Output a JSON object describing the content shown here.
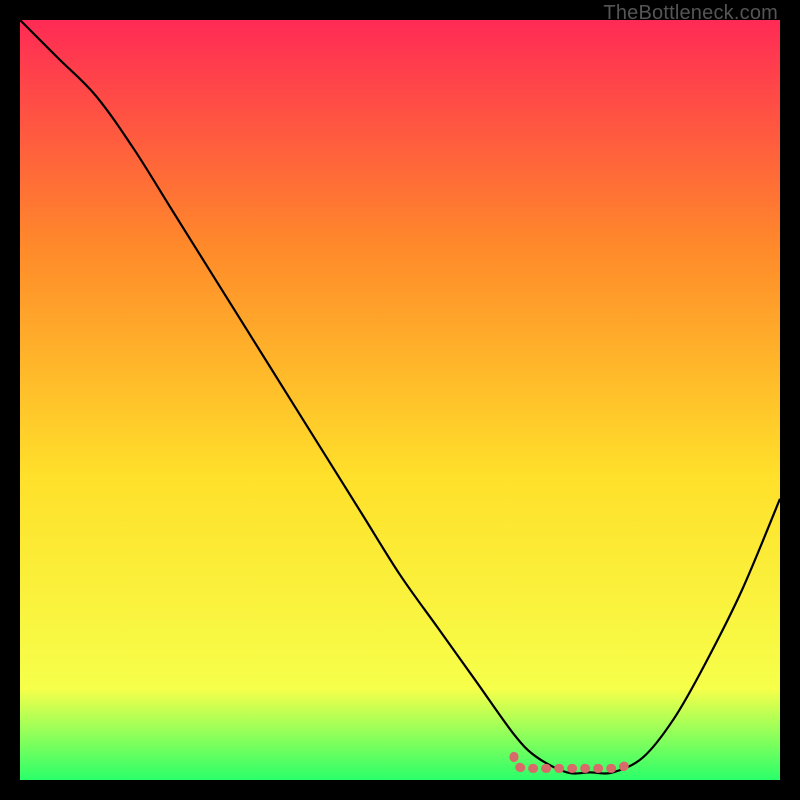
{
  "watermark": "TheBottleneck.com",
  "colors": {
    "gradient_top": "#ff2a55",
    "gradient_mid_up": "#ff8a2a",
    "gradient_mid": "#ffe02a",
    "gradient_low": "#f6ff4a",
    "gradient_bottom": "#2aff6a",
    "curve": "#000000",
    "highlight": "#d86a6a",
    "frame": "#000000"
  },
  "chart_data": {
    "type": "line",
    "title": "",
    "xlabel": "",
    "ylabel": "",
    "xlim": [
      0,
      100
    ],
    "ylim": [
      0,
      100
    ],
    "grid": false,
    "legend": false,
    "series": [
      {
        "name": "bottleneck-curve",
        "x": [
          0,
          5,
          10,
          15,
          20,
          25,
          30,
          35,
          40,
          45,
          50,
          55,
          60,
          65,
          68,
          72,
          75,
          78,
          82,
          86,
          90,
          95,
          100
        ],
        "values": [
          100,
          95,
          90,
          83,
          75,
          67,
          59,
          51,
          43,
          35,
          27,
          20,
          13,
          6,
          3,
          1,
          1,
          1,
          3,
          8,
          15,
          25,
          37
        ]
      }
    ],
    "annotations": [
      {
        "name": "optimal-range",
        "x_start": 65,
        "x_end": 80,
        "y": 1
      }
    ]
  }
}
